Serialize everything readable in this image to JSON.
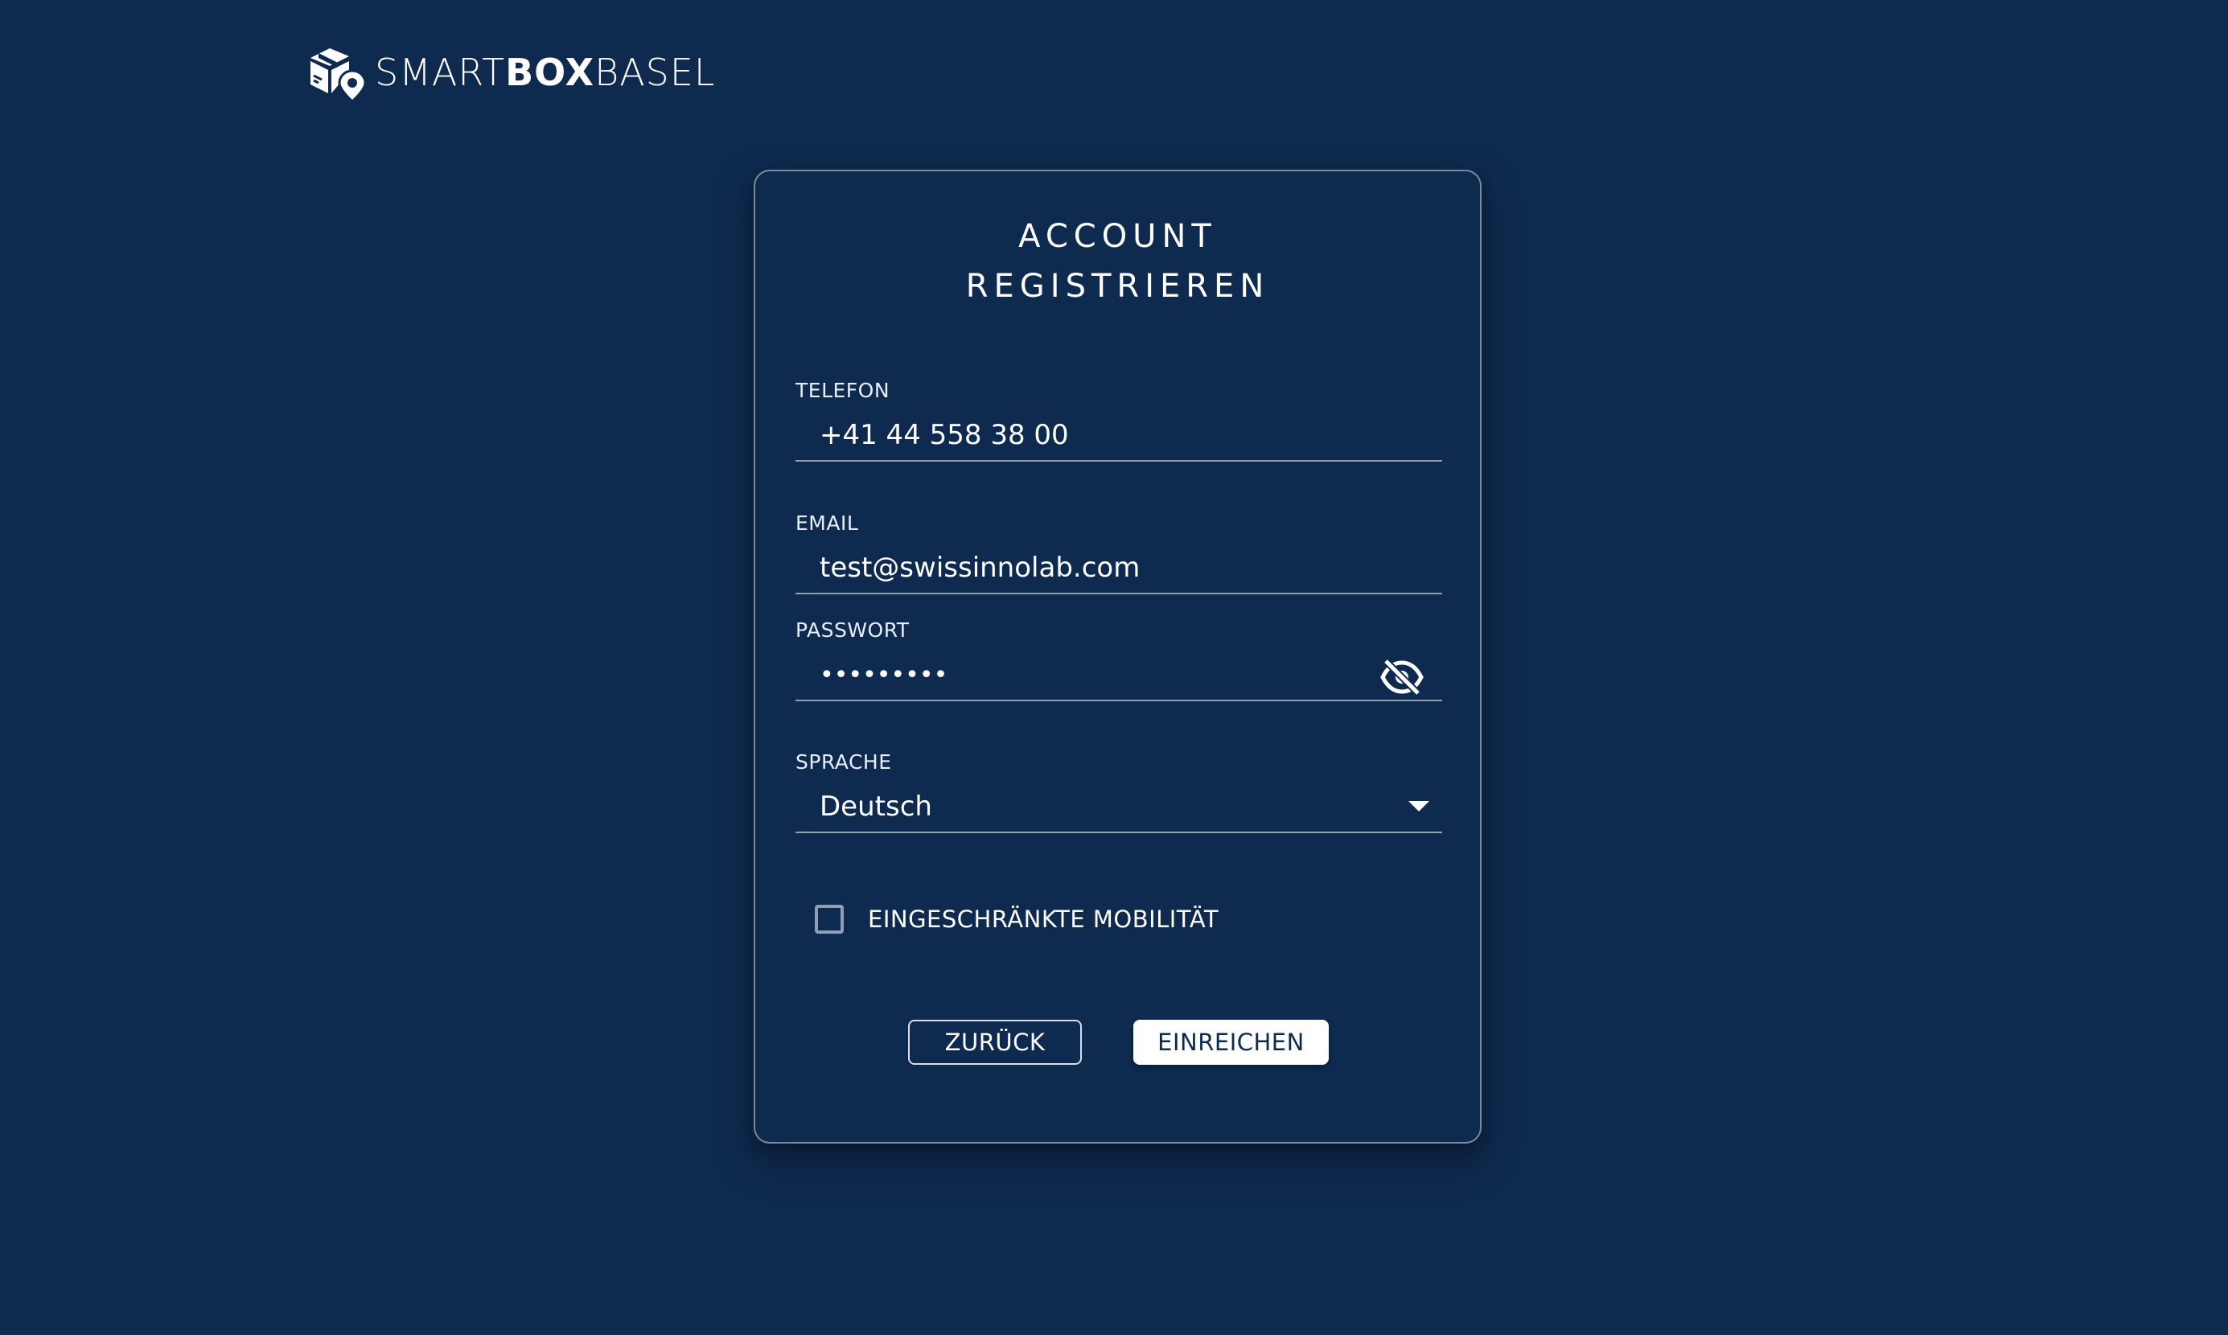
{
  "brand": {
    "name_part1": "SMART",
    "name_part2": "BOX",
    "name_part3": "BASEL"
  },
  "card": {
    "title_line1": "ACCOUNT",
    "title_line2": "REGISTRIEREN"
  },
  "form": {
    "telefon": {
      "label": "TELEFON",
      "value": "+41 44 558 38 00"
    },
    "email": {
      "label": "EMAIL",
      "value": "test@swissinnolab.com"
    },
    "passwort": {
      "label": "PASSWORT",
      "masked_value": "•••••••••",
      "toggle_icon": "eye-off-icon"
    },
    "sprache": {
      "label": "SPRACHE",
      "selected": "Deutsch"
    },
    "mobility": {
      "label": "EINGESCHRÄNKTE MOBILITÄT",
      "checked": false
    }
  },
  "buttons": {
    "back": "ZURÜCK",
    "submit": "EINREICHEN"
  },
  "colors": {
    "background": "#0e2a4f",
    "text": "#ffffff",
    "border": "#8ea0b8"
  }
}
